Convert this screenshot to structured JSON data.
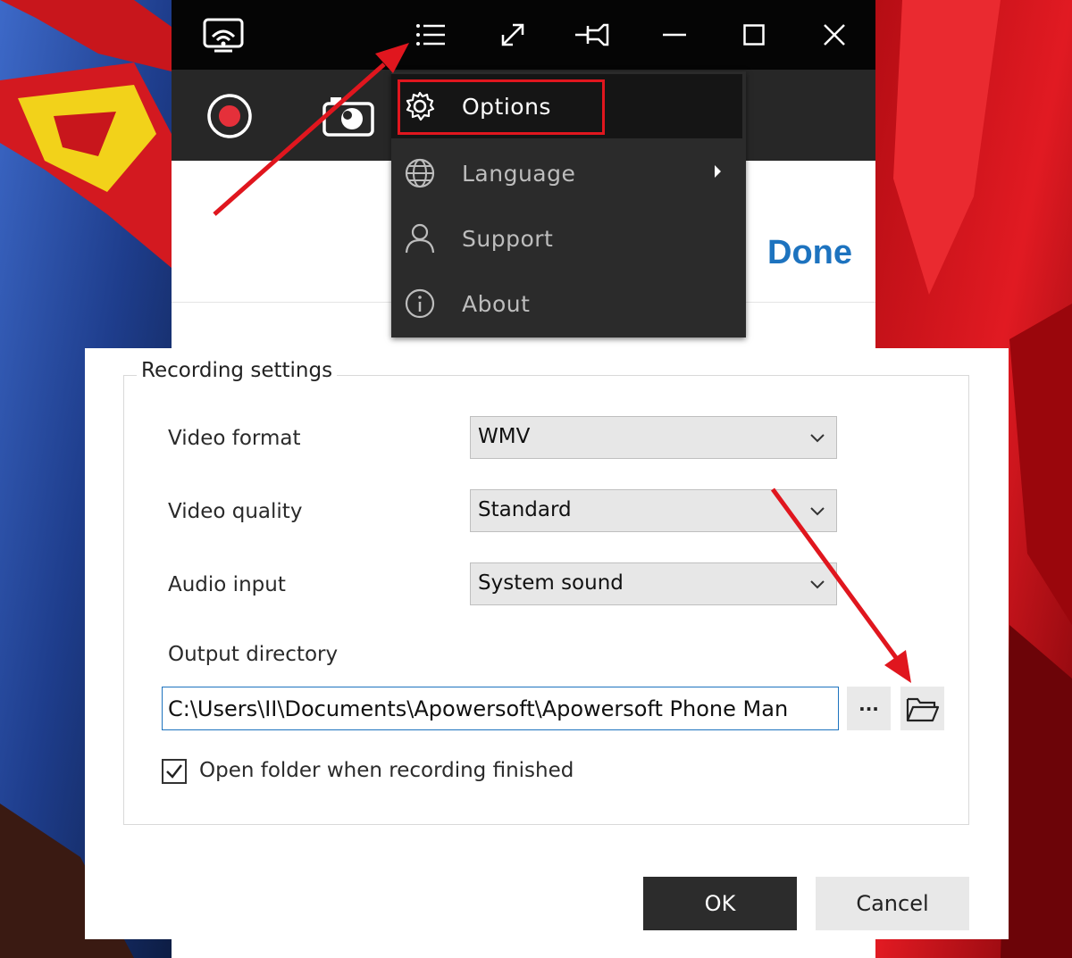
{
  "colors": {
    "titlebar": "#050505",
    "toolbar": "#272727",
    "menu_bg": "#2b2b2b",
    "menu_text_active": "#ffffff",
    "menu_text_dim": "#bdbdbd",
    "accent_blue": "#1d73bf",
    "highlight_red": "#e0161e",
    "ok_bg": "#2c2c2c"
  },
  "titlebar": {
    "icons": [
      "screen-mirror-icon",
      "menu-list-icon",
      "expand-icon",
      "pin-icon",
      "minimize-icon",
      "maximize-icon",
      "close-icon"
    ]
  },
  "toolbar": {
    "icons": [
      "record-icon",
      "screenshot-camera-icon"
    ]
  },
  "done_label": "Done",
  "menu": {
    "items": [
      {
        "label": "Options",
        "icon": "gear-icon",
        "active": true
      },
      {
        "label": "Language",
        "icon": "globe-icon",
        "has_submenu": true
      },
      {
        "label": "Support",
        "icon": "user-icon"
      },
      {
        "label": "About",
        "icon": "info-icon"
      }
    ]
  },
  "dialog": {
    "group_title": "Recording settings",
    "video_format": {
      "label": "Video format",
      "value": "WMV"
    },
    "video_quality": {
      "label": "Video quality",
      "value": "Standard"
    },
    "audio_input": {
      "label": "Audio input",
      "value": "System sound"
    },
    "output_directory": {
      "label": "Output directory",
      "value": "C:\\Users\\II\\Documents\\Apowersoft\\Apowersoft Phone Man",
      "more_label": "···"
    },
    "open_folder": {
      "label": "Open folder when recording finished",
      "checked": true
    },
    "ok_label": "OK",
    "cancel_label": "Cancel"
  }
}
